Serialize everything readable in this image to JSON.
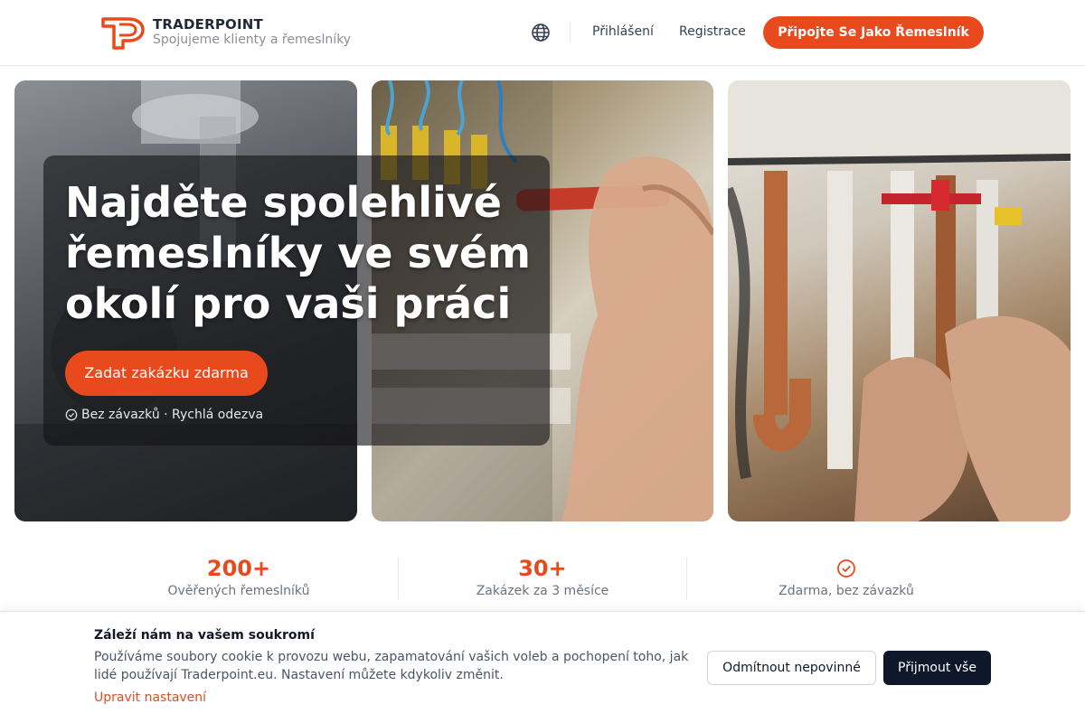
{
  "header": {
    "brand_name": "TRADERPOINT",
    "brand_tagline": "Spojujeme klienty a řemeslníky",
    "login_label": "Přihlášení",
    "register_label": "Registrace",
    "join_label": "Připojte Se Jako Řemeslník",
    "language_icon": "globe-icon"
  },
  "hero": {
    "title": "Najděte spolehlivé řemeslníky ve svém okolí pro vaši práci",
    "cta_label": "Zadat zakázku zdarma",
    "note": "Bez závazků · Rychlá odezva",
    "note_icon": "check-circle-icon",
    "images": [
      "plumber-under-sink-photo",
      "electrician-fuse-box-photo",
      "copper-pipes-valves-photo"
    ]
  },
  "stats": [
    {
      "value": "200+",
      "label": "Ověřených řemeslníků"
    },
    {
      "value": "30+",
      "label": "Zakázek za 3 měsíce"
    },
    {
      "icon": "check-circle-icon",
      "label": "Zdarma, bez závazků"
    }
  ],
  "cookie": {
    "title": "Záleží nám na vašem soukromí",
    "text": "Používáme soubory cookie k provozu webu, zapamatování vašich voleb a pochopení toho, jak lidé používají Traderpoint.eu. Nastavení můžete kdykoliv změnit.",
    "settings_link": "Upravit nastavení",
    "decline_label": "Odmítnout nepovinné",
    "accept_label": "Přijmout vše"
  },
  "colors": {
    "accent": "#e8491d",
    "dark_button": "#0f172a"
  }
}
